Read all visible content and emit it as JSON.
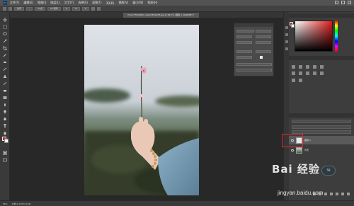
{
  "menubar": {
    "logo": "Ps",
    "items": [
      "文件(F)",
      "编辑(E)",
      "图像(I)",
      "图层(L)",
      "文字(Y)",
      "选择(S)",
      "滤镜(T)",
      "3D(D)",
      "视图(V)",
      "窗口(W)",
      "帮助(H)"
    ]
  },
  "optionsbar": {
    "items": [
      "仿宋",
      "-",
      "24点",
      "aa 锐利",
      "≡",
      "≣",
      "≡"
    ]
  },
  "document": {
    "tab_label": "7ac4c7f19d48d..a1bd18c9b2ff.jpg @ 66.7% (图层 1, RGB/8#) *"
  },
  "layers": {
    "rows": [
      {
        "name": "图层 1",
        "selected": true
      },
      {
        "name": "背景",
        "selected": false
      }
    ]
  },
  "fps": "59",
  "statusbar": {
    "zoom": "66%",
    "doc_info": "文档:2.07M/4.14M"
  },
  "watermark": {
    "logo_text": "Bai 经验",
    "url": "jingyan.baidu.com"
  },
  "colors": {
    "foreground": "#c0262b",
    "background": "#ffffff",
    "highlight_box": "#e8262b"
  }
}
